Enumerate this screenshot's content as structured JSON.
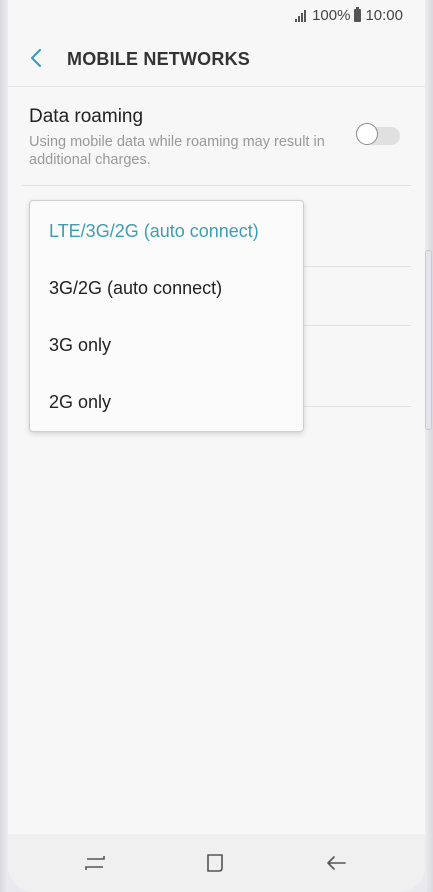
{
  "status_bar": {
    "battery_percent": "100%",
    "time": "10:00"
  },
  "header": {
    "title": "MOBILE NETWORKS"
  },
  "data_roaming": {
    "title": "Data roaming",
    "description": "Using mobile data while roaming may result in additional charges.",
    "enabled": false
  },
  "network_mode_menu": {
    "options": [
      {
        "label": "LTE/3G/2G (auto connect)",
        "selected": true
      },
      {
        "label": "3G/2G (auto connect)",
        "selected": false
      },
      {
        "label": "3G only",
        "selected": false
      },
      {
        "label": "2G only",
        "selected": false
      }
    ]
  },
  "colors": {
    "accent": "#3f9db0"
  },
  "navigation": {
    "icons": [
      "recent-apps-icon",
      "home-icon",
      "back-icon"
    ]
  }
}
